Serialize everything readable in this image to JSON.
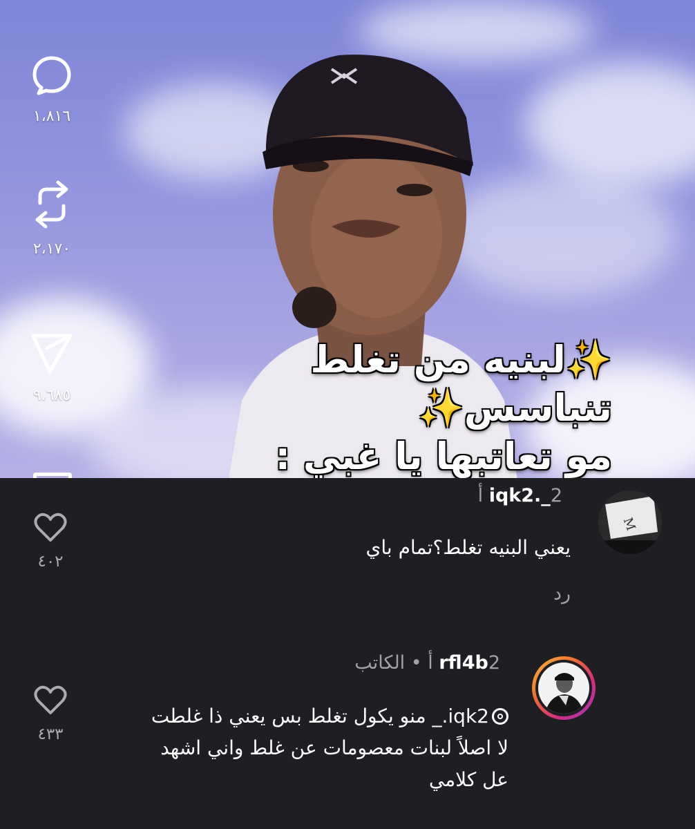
{
  "video": {
    "overlay_caption": {
      "sparkle": "✨",
      "line1": "لبنيه من تغلط تنباسس",
      "line2": "مو تعاتبها يا غبي :"
    },
    "actions": [
      {
        "icon": "comment-icon",
        "count": "١،٨١٦"
      },
      {
        "icon": "repost-icon",
        "count": "٢،١٧٠"
      },
      {
        "icon": "send-icon",
        "count": "٩،٦٨٥"
      }
    ]
  },
  "comments": [
    {
      "username": "iqk2._",
      "meta": "2 أ",
      "text": "يعني البنيه تغلط؟تمام باي",
      "reply_label": "رد",
      "like_count": "٤٠٢"
    },
    {
      "username": "rfl4b",
      "meta": "2 أ • الكاتب",
      "mention": "iqk2._",
      "text_lines": [
        "منو يكول تغلط بس يعني ذا غلطت",
        "لا اصلاً لبنات معصومات عن غلط واني اشهد",
        "عل كلامي"
      ],
      "like_count": "٤٣٣"
    }
  ],
  "colors": {
    "background": "#1e1f23",
    "muted_text": "#a0a2a8",
    "text": "#ffffff"
  }
}
